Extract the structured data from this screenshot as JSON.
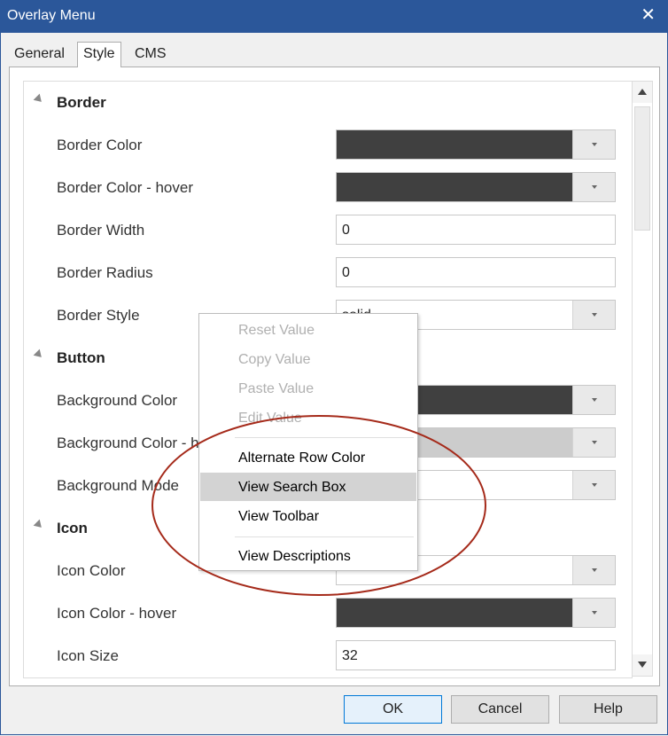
{
  "window": {
    "title": "Overlay Menu",
    "close_glyph": "✕"
  },
  "tabs": [
    {
      "label": "General",
      "active": false
    },
    {
      "label": "Style",
      "active": true
    },
    {
      "label": "CMS",
      "active": false
    }
  ],
  "grid": {
    "rows": [
      {
        "kind": "category",
        "label": "Border"
      },
      {
        "kind": "color",
        "label": "Border Color",
        "color": "#404040"
      },
      {
        "kind": "color",
        "label": "Border Color - hover",
        "color": "#404040"
      },
      {
        "kind": "text",
        "label": "Border Width",
        "value": "0"
      },
      {
        "kind": "text",
        "label": "Border Radius",
        "value": "0"
      },
      {
        "kind": "select",
        "label": "Border Style",
        "value": "solid"
      },
      {
        "kind": "category",
        "label": "Button"
      },
      {
        "kind": "color",
        "label": "Background Color",
        "color": "#404040"
      },
      {
        "kind": "color",
        "label": "Background Color - hover",
        "color": "#cccccc"
      },
      {
        "kind": "select",
        "label": "Background Mode",
        "value": ""
      },
      {
        "kind": "category",
        "label": "Icon"
      },
      {
        "kind": "color",
        "label": "Icon Color",
        "color": "#ffffff"
      },
      {
        "kind": "color",
        "label": "Icon Color - hover",
        "color": "#404040"
      },
      {
        "kind": "text",
        "label": "Icon Size",
        "value": "32"
      }
    ]
  },
  "context_menu": {
    "items": [
      {
        "label": "Reset Value",
        "enabled": false
      },
      {
        "label": "Copy Value",
        "enabled": false
      },
      {
        "label": "Paste Value",
        "enabled": false
      },
      {
        "label": "Edit Value",
        "enabled": false
      },
      {
        "separator": true
      },
      {
        "label": "Alternate Row Color",
        "enabled": true
      },
      {
        "label": "View Search Box",
        "enabled": true,
        "highlighted": true
      },
      {
        "label": "View Toolbar",
        "enabled": true
      },
      {
        "separator": true
      },
      {
        "label": "View Descriptions",
        "enabled": true
      }
    ]
  },
  "annotation": {
    "shape": "ellipse",
    "color": "#a52a1a"
  },
  "buttons": {
    "ok": "OK",
    "cancel": "Cancel",
    "help": "Help"
  },
  "colors": {
    "titlebar": "#2b579a",
    "accent": "#0078d7"
  }
}
